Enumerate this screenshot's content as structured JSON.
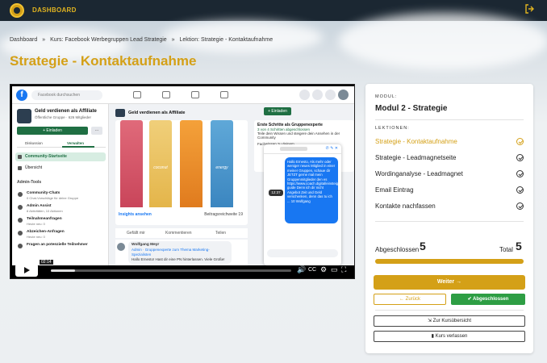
{
  "header": {
    "nav_label": "DASHBOARD",
    "logout_icon": "logout-icon"
  },
  "breadcrumb": [
    "Dashboard",
    "»",
    "Kurs: Facebook Werbegruppen Lead Strategie",
    "»",
    "Lektion: Strategie - Kontaktaufnahme"
  ],
  "page_title": "Strategie - Kontaktaufnahme",
  "video": {
    "timestamp": "02:14",
    "progress_fraction": 0.1,
    "facebook": {
      "search_placeholder": "Facebook durchsuchen",
      "group_name": "Geld verdienen als Affiliate",
      "group_meta": "Öffentliche Gruppe · 626 Mitglieder",
      "invite_label": "+ Einladen",
      "more_label": "···",
      "tab_discussion": "Diskussion",
      "tab_manage": "Verwalten",
      "side_items": [
        "Community-Startseite",
        "Übersicht"
      ],
      "admin_heading": "Admin-Tools",
      "admin_items": [
        {
          "title": "Community-Chats",
          "sub": "0 Chat-Vorschläge für deine Gruppe"
        },
        {
          "title": "Admin Assist",
          "sub": "8 Aktivitäten, 10 Aktionen"
        },
        {
          "title": "Teilnahmeanfragen",
          "sub": "Heute neu: 0"
        },
        {
          "title": "Abzeichen-Anfragen",
          "sub": "Heute neu: 0"
        },
        {
          "title": "Fragen an potenzielle Teilnehmer",
          "sub": ""
        }
      ],
      "main_group_name": "Geld verdienen als Affiliate",
      "can_labels": [
        "",
        "coconut",
        "",
        "energy"
      ],
      "insights_label": "Insights ansehen",
      "reach_label": "Beitragsreichweite  19",
      "actions": [
        "Gefällt mir",
        "Kommentieren",
        "Teilen"
      ],
      "comment_author": "Wolfgang Meyr",
      "comment_sub": "Admin · Gruppenexperte zum Thema Marketing-Spezialisten",
      "comment_text": "Hallo Ernesto! Hast dir eine PN hinterlassen. Viele Grüße!",
      "right_invite": "+ Einladen",
      "guide_title": "Erste Schritte als Gruppenexperte",
      "guide_count": "3 von 4 Schritten abgeschlossen",
      "guide_text": "Teile dein Wissen und steigere dein Ansehen in der Community",
      "guide_item": "Fachwissen zu deinem",
      "chat_time": "12:37",
      "chat_message": "Hallo Ernesto, Als mehr oder weniger neues Mitglied in einer meiner Gruppen, schaue dir JETZT gerne mal mein Gruppenmitglieder den es https://www.coach.digital/einsteiger-guide Denn ich dir nicht Angebot Zeit und Geld verschenken, denn das tu ich ... 10 Wolfgang"
    }
  },
  "sidebar": {
    "overline": "MODUL:",
    "module_title": "Modul 2 - Strategie",
    "lessons_heading": "LEKTIONEN:",
    "lessons": [
      {
        "label": "Strategie - Kontaktaufnahme",
        "active": true
      },
      {
        "label": "Strategie - Leadmagnetseite",
        "active": false
      },
      {
        "label": "Wordinganalyse - Leadmagnet",
        "active": false
      },
      {
        "label": "Email Eintrag",
        "active": false
      },
      {
        "label": "Kontakte nachfassen",
        "active": false
      }
    ],
    "completed_label": "Abgeschlossen",
    "completed_value": "5",
    "total_label": "Total",
    "total_value": "5",
    "progress_fraction": 1.0,
    "next_label": "Weiter →",
    "back_label": "← Zurück",
    "done_label": "✔ Abgeschlossen",
    "overview_label": "⇲ Zur Kursübersicht",
    "leave_label": "▮ Kurs verlassen"
  },
  "colors": {
    "accent": "#d4a017",
    "dark": "#1b2732",
    "success": "#2e9e44",
    "facebook": "#1877f2"
  }
}
